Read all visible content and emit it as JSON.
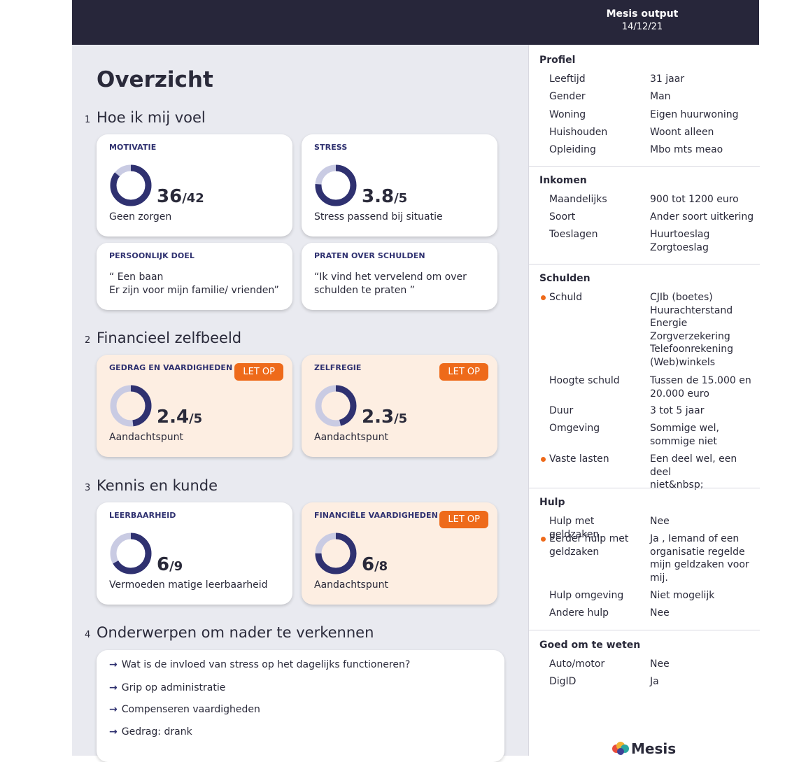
{
  "header": {
    "title": "Mesis output",
    "date": "14/12/21"
  },
  "main": {
    "title": "Overzicht",
    "sections": [
      {
        "num": "1",
        "title": "Hoe ik mij voel"
      },
      {
        "num": "2",
        "title": "Financieel zelfbeeld"
      },
      {
        "num": "3",
        "title": "Kennis en kunde"
      },
      {
        "num": "4",
        "title": "Onderwerpen om nader te verkennen"
      }
    ],
    "cards": {
      "motivatie": {
        "label": "MOTIVATIE",
        "score": "36",
        "max": "/42",
        "desc": "Geen zorgen",
        "fraction": 0.857
      },
      "stress": {
        "label": "STRESS",
        "score": "3.8",
        "max": "/5",
        "desc": "Stress passend bij situatie",
        "fraction": 0.76
      },
      "doel": {
        "label": "PERSOONLIJK DOEL",
        "text": "“ Een baan\nEr zijn voor mijn familie/ vrienden”"
      },
      "praten": {
        "label": "PRATEN OVER SCHULDEN",
        "text": "“Ik vind het vervelend om over\nschulden te praten ”"
      },
      "gedrag": {
        "label": "GEDRAG EN VAARDIGHEDEN",
        "badge": "LET OP",
        "score": "2.4",
        "max": "/5",
        "desc": "Aandachtspunt",
        "fraction": 0.48
      },
      "zelfregie": {
        "label": "ZELFREGIE",
        "badge": "LET OP",
        "score": "2.3",
        "max": "/5",
        "desc": "Aandachtspunt",
        "fraction": 0.46
      },
      "leerbaarheid": {
        "label": "LEERBAARHEID",
        "score": "6",
        "max": "/9",
        "desc": "Vermoeden matige leerbaarheid",
        "fraction": 0.667
      },
      "financiele": {
        "label": "FINANCIËLE VAARDIGHEDEN",
        "badge": "LET OP",
        "score": "6",
        "max": "/8",
        "desc": "Aandachtspunt",
        "fraction": 0.75
      }
    },
    "topics": [
      "Wat is de invloed van stress op het dagelijks functioneren?",
      "Grip op administratie",
      "Compenseren vaardigheden",
      "Gedrag: drank"
    ],
    "arrow": "→"
  },
  "sidebar": {
    "profiel": {
      "title": "Profiel",
      "rows": [
        {
          "k": "Leeftijd",
          "v": "31 jaar"
        },
        {
          "k": "Gender",
          "v": "Man"
        },
        {
          "k": "Woning",
          "v": "Eigen huurwoning"
        },
        {
          "k": "Huishouden",
          "v": "Woont alleen"
        },
        {
          "k": "Opleiding",
          "v": "Mbo mts meao"
        }
      ]
    },
    "inkomen": {
      "title": "Inkomen",
      "rows": [
        {
          "k": "Maandelijks",
          "v": "900 tot 1200 euro"
        },
        {
          "k": "Soort",
          "v": "Ander soort uitkering"
        },
        {
          "k": "Toeslagen",
          "v": "Huurtoeslag\nZorgtoeslag"
        }
      ]
    },
    "schulden": {
      "title": "Schulden",
      "rows": [
        {
          "k": "Schuld",
          "v": "CJIb (boetes)\nHuurachterstand\nEnergie\nZorgverzekering\nTelefoonrekening\n(Web)winkels"
        },
        {
          "k": "Hoogte schuld",
          "v": "Tussen de 15.000 en\n20.000 euro"
        },
        {
          "k": "Duur",
          "v": "3 tot 5 jaar"
        },
        {
          "k": "Omgeving",
          "v": "Sommige wel,\nsommige niet"
        },
        {
          "k": "Vaste lasten",
          "v": "Een deel wel, een deel\nniet&nbsp;"
        }
      ]
    },
    "hulp": {
      "title": "Hulp",
      "rows": [
        {
          "k": "Hulp met geldzaken",
          "v": "Nee"
        },
        {
          "k": "Eerder hulp met geldzaken",
          "v": "Ja , Iemand of een\norganisatie regelde\nmijn geldzaken voor\nmij."
        },
        {
          "k": "Hulp omgeving",
          "v": "Niet mogelijk"
        },
        {
          "k": "Andere hulp",
          "v": "Nee"
        }
      ]
    },
    "goed": {
      "title": "Goed om te weten",
      "rows": [
        {
          "k": "Auto/motor",
          "v": "Nee"
        },
        {
          "k": "DigID",
          "v": "Ja"
        }
      ]
    },
    "logo": "Mesis"
  },
  "colors": {
    "navy": "#2f3170",
    "ring_track": "#c9cbe3",
    "warn": "#ee6a1a",
    "warn_bg": "#fdeee2",
    "header_bg": "#27263a"
  }
}
